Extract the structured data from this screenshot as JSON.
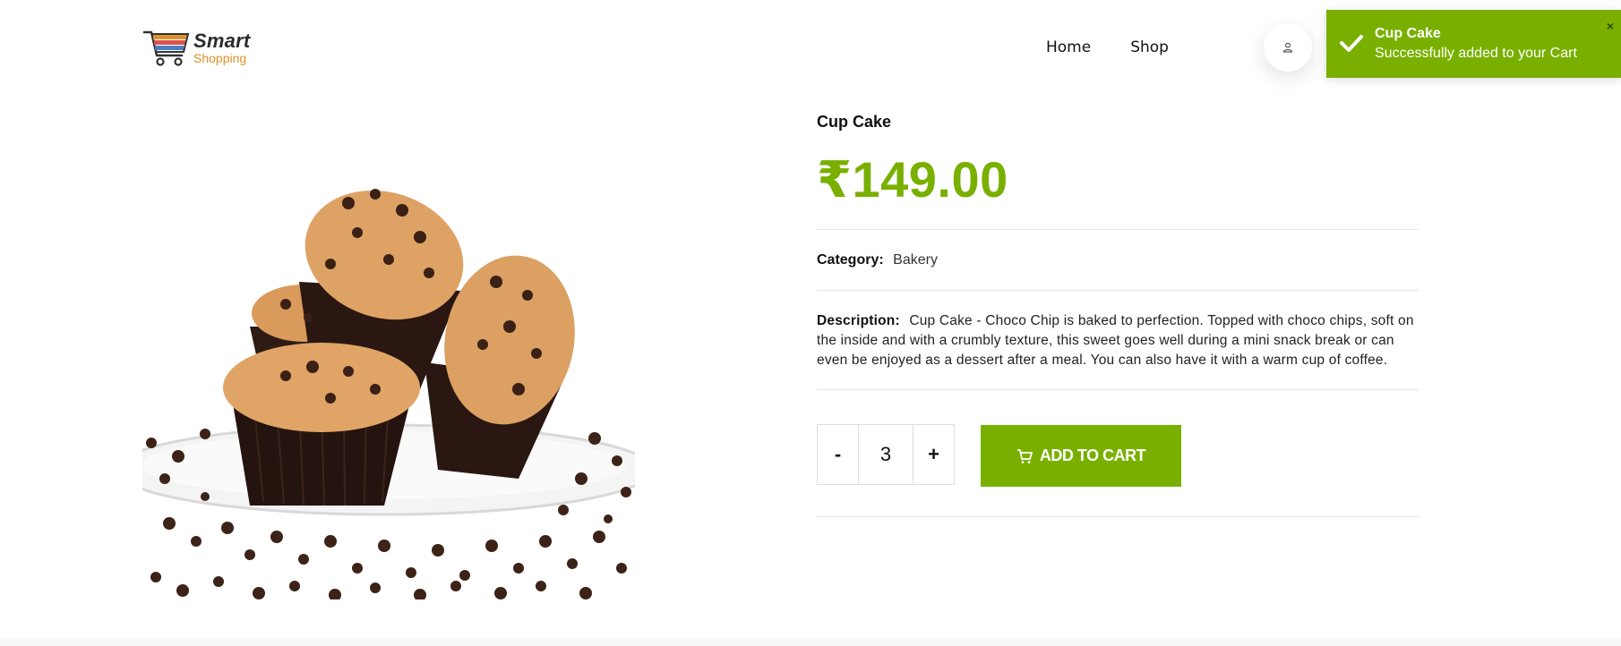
{
  "brand": {
    "name_line1": "Smart",
    "name_line2": "Shopping",
    "accent_color": "#e0912b",
    "primary_color": "#79b000"
  },
  "nav": {
    "items": [
      {
        "label": "Home"
      },
      {
        "label": "Shop"
      }
    ]
  },
  "user": {
    "icon": "user-icon"
  },
  "product": {
    "title": "Cup Cake",
    "price": "₹149.00",
    "category_label": "Category:",
    "category_value": "Bakery",
    "description_label": "Description:",
    "description_text": "Cup Cake - Choco Chip is baked to perfection. Topped with choco chips, soft on the inside and with a crumbly texture, this sweet goes well during a mini snack break or can even be enjoyed as a dessert after a meal. You can also have it with a warm cup of coffee.",
    "image_icon": "cupcake-product-image"
  },
  "quantity": {
    "minus_label": "-",
    "value": "3",
    "plus_label": "+"
  },
  "cart": {
    "add_label": "ADD TO CART",
    "icon": "cart-icon"
  },
  "toast": {
    "title": "Cup Cake",
    "message": "Successfully added to your Cart",
    "close_label": "×",
    "icon": "check-icon"
  }
}
